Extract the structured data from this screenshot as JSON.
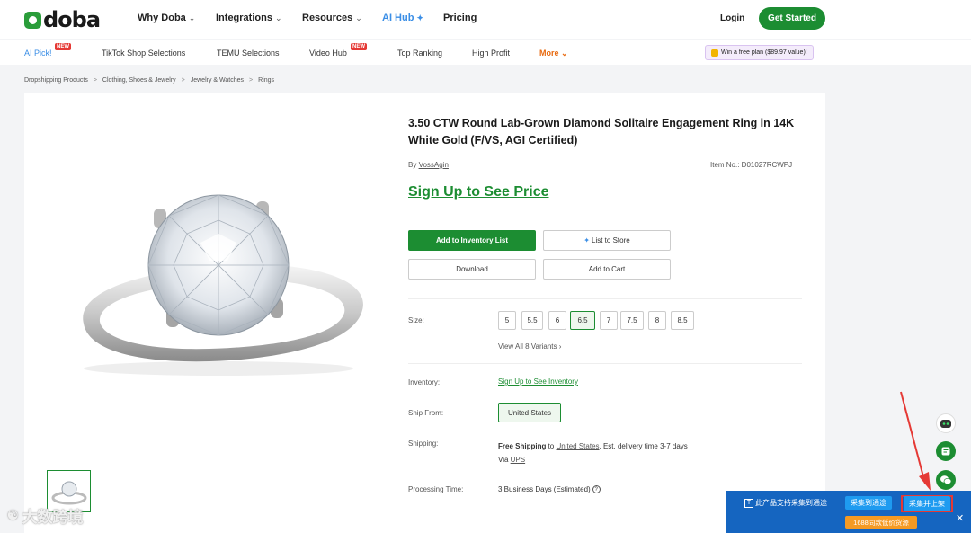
{
  "brand": {
    "name": "doba"
  },
  "topnav": {
    "items": [
      {
        "label": "Why Doba",
        "has_chevron": true
      },
      {
        "label": "Integrations",
        "has_chevron": true
      },
      {
        "label": "Resources",
        "has_chevron": true
      },
      {
        "label": "AI Hub",
        "icon": "sparkle-icon"
      },
      {
        "label": "Pricing"
      }
    ],
    "login": "Login",
    "cta": "Get Started"
  },
  "subnav": {
    "items": [
      {
        "label": "AI Pick!",
        "badge": "NEW"
      },
      {
        "label": "TikTok Shop Selections"
      },
      {
        "label": "TEMU Selections"
      },
      {
        "label": "Video Hub",
        "badge": "NEW"
      },
      {
        "label": "Top Ranking"
      },
      {
        "label": "High Profit"
      },
      {
        "label": "More"
      }
    ],
    "promo": "Win a free plan ($89.97 value)!"
  },
  "breadcrumb": [
    "Dropshipping Products",
    "Clothing, Shoes & Jewelry",
    "Jewelry & Watches",
    "Rings"
  ],
  "product": {
    "title": "3.50 CTW Round Lab-Grown Diamond Solitaire Engagement Ring in 14K White Gold (F/VS, AGI Certified)",
    "by_prefix": "By",
    "seller": "VossAgin",
    "item_no": "Item No.: D01027RCWPJ",
    "price_cta": "Sign Up to See Price",
    "buttons": {
      "add_inventory": "Add to Inventory List",
      "list_to_store": "List to Store",
      "download": "Download",
      "add_to_cart": "Add to Cart"
    },
    "size_label": "Size:",
    "sizes": [
      "5",
      "5.5",
      "6",
      "6.5",
      "7",
      "7.5",
      "8",
      "8.5"
    ],
    "selected_size": "6.5",
    "view_all": "View All 8 Variants",
    "inventory_label": "Inventory:",
    "inventory_link": "Sign Up to See Inventory",
    "ship_from_label": "Ship From:",
    "ship_from": "United States",
    "shipping_label": "Shipping:",
    "shipping_free": "Free Shipping",
    "shipping_to": "to",
    "shipping_country": "United States",
    "shipping_est": ", Est. delivery time 3-7 days",
    "shipping_via": "Via",
    "shipping_carrier": "UPS",
    "processing_label": "Processing Time:",
    "processing_value": "3 Business Days (Estimated)"
  },
  "plugin": {
    "text": "此产品支持采集到通途",
    "btn_collect": "采集到通途",
    "btn_collect_list": "采集并上架",
    "orange": "1688同款低价货源"
  },
  "watermark": "大数跨境",
  "colors": {
    "brand_green": "#1c8d32",
    "ai_blue": "#3a8ee6",
    "plugin_blue": "#1565c0"
  }
}
